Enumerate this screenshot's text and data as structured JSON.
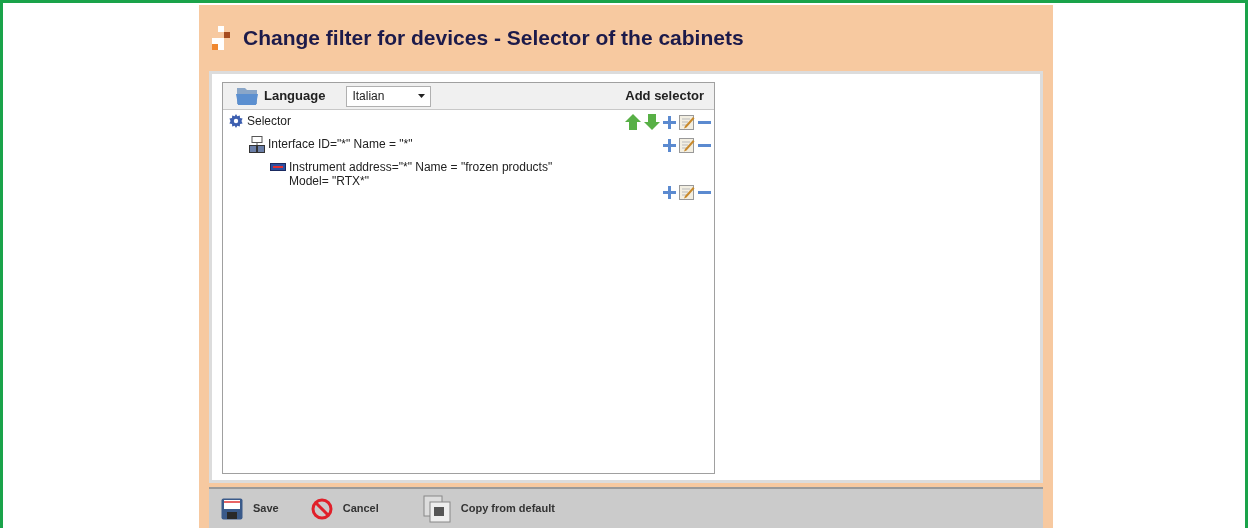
{
  "window": {
    "title": "Change filter for devices - Selector of the cabinets"
  },
  "toolbar": {
    "language_label": "Language",
    "language_value": "Italian",
    "add_label": "Add selector"
  },
  "tree": [
    {
      "kind": "selector",
      "lines": [
        "Selector"
      ],
      "movable": true,
      "children": [
        {
          "kind": "interface",
          "lines": [
            "Interface ID=\"*\" Name = \"*\""
          ],
          "movable": false,
          "children": [
            {
              "kind": "instrument",
              "lines": [
                "Instrument address=\"*\" Name = \"frozen products\"",
                "Model= \"RTX*\""
              ],
              "movable": false
            }
          ]
        }
      ]
    }
  ],
  "footer": [
    {
      "kind": "save",
      "label": "Save"
    },
    {
      "kind": "cancel",
      "label": "Cancel"
    },
    {
      "kind": "copy",
      "label": "Copy from default"
    }
  ]
}
